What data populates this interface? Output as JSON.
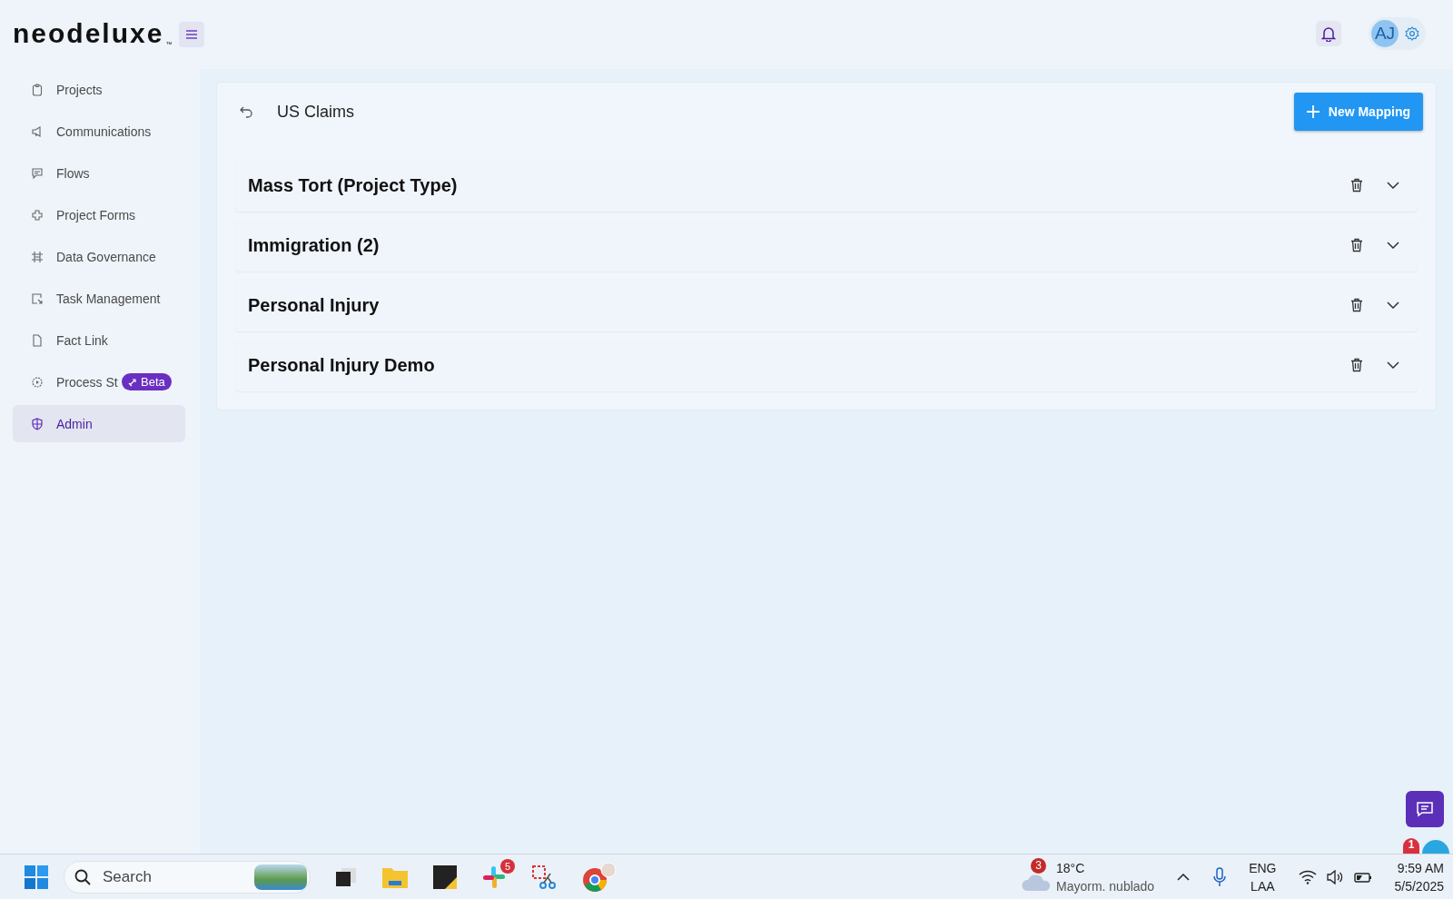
{
  "header": {
    "logo": "neodeluxe",
    "logo_mark": "™",
    "avatar": "AJ"
  },
  "sidebar": {
    "items": [
      {
        "label": "Projects",
        "selected": false
      },
      {
        "label": "Communications",
        "selected": false
      },
      {
        "label": "Flows",
        "selected": false
      },
      {
        "label": "Project Forms",
        "selected": false
      },
      {
        "label": "Data Governance",
        "selected": false
      },
      {
        "label": "Task Management",
        "selected": false
      },
      {
        "label": "Fact Link",
        "selected": false
      },
      {
        "label": "Process St",
        "selected": false,
        "badge": "Beta"
      },
      {
        "label": "Admin",
        "selected": true
      }
    ]
  },
  "page": {
    "title": "US Claims",
    "new_button": "New Mapping",
    "mappings": [
      {
        "name": "Mass Tort (Project Type)",
        "expanded": false
      },
      {
        "name": "Immigration (2)",
        "expanded": false
      },
      {
        "name": "Personal Injury",
        "expanded": false
      },
      {
        "name": "Personal Injury Demo",
        "expanded": false
      }
    ]
  },
  "chat_widget": {
    "badge": "1"
  },
  "taskbar": {
    "search_placeholder": "Search",
    "slack_badge": "5",
    "weather_badge": "3",
    "temperature": "18°C",
    "weather": "Mayorm. nublado",
    "language": "ENG",
    "layout": "LAA",
    "time": "9:59 AM",
    "date": "5/5/2025"
  }
}
